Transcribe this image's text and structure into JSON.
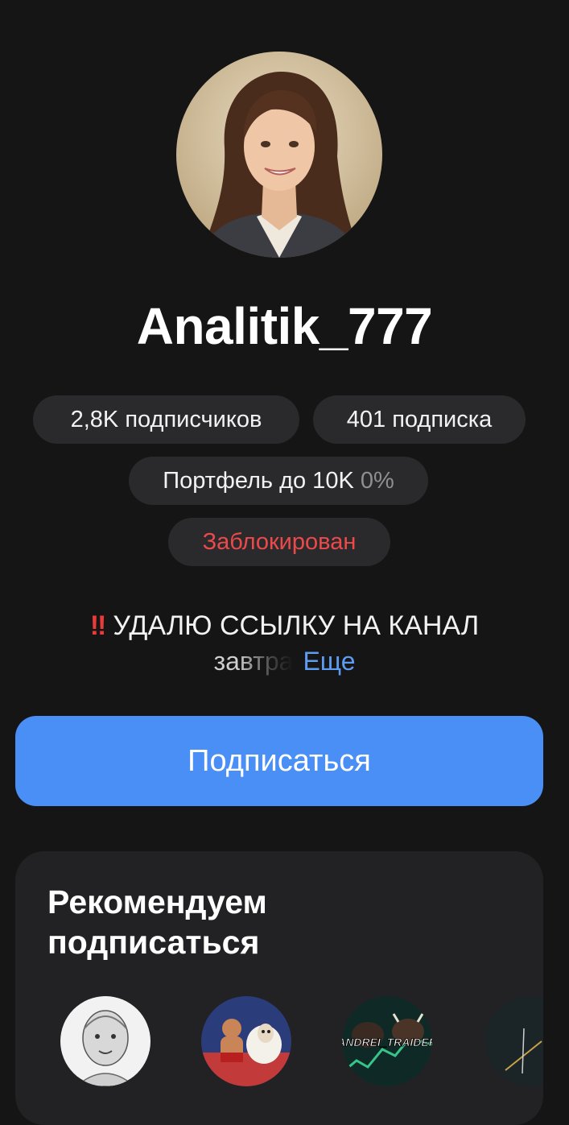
{
  "profile": {
    "username": "Analitik_777",
    "followers": "2,8K подписчиков",
    "following": "401 подписка",
    "portfolio_label": "Портфель до 10K",
    "portfolio_value": "0%",
    "blocked": "Заблокирован",
    "status_emoji": "‼",
    "status_line1": "УДАЛЮ ССЫЛКУ НА КАНАЛ",
    "status_line2": "завтра",
    "status_more": "Еще"
  },
  "actions": {
    "subscribe_label": "Подписаться"
  },
  "recommendations": {
    "title": "Рекомендуем подписаться",
    "items": [
      {
        "icon": "sketch-portrait-avatar"
      },
      {
        "icon": "wrestler-sheep-avatar"
      },
      {
        "icon": "bull-bear-trader-avatar",
        "label": "ANDREI_TRAIDER"
      },
      {
        "icon": "chart-line-avatar"
      }
    ]
  },
  "colors": {
    "background": "#151515",
    "chip": "#2a2a2c",
    "accent": "#4a8ff5",
    "link": "#5d9cf0",
    "danger": "#ec4a4a",
    "card": "#222224"
  }
}
